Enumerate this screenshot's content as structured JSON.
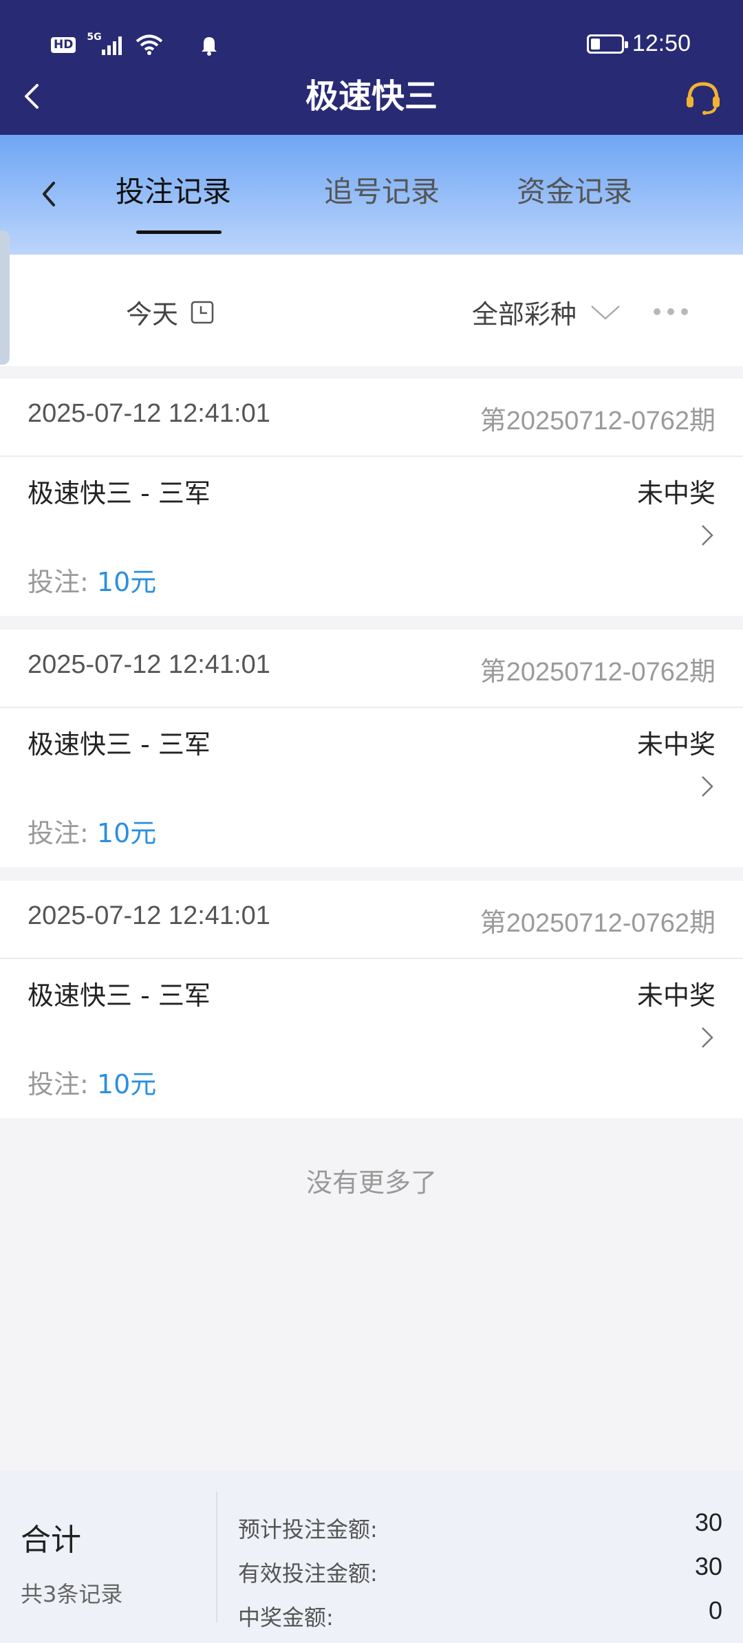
{
  "status_bar": {
    "hd": "HD",
    "network": "5G",
    "time": "12:50",
    "battery_level": 0.3
  },
  "header": {
    "title": "极速快三"
  },
  "tabs": [
    {
      "label": "投注记录",
      "active": true
    },
    {
      "label": "追号记录",
      "active": false
    },
    {
      "label": "资金记录",
      "active": false
    }
  ],
  "filter": {
    "date": "今天",
    "lottery_type": "全部彩种"
  },
  "records": [
    {
      "time": "2025-07-12 12:41:01",
      "period": "第20250712-0762期",
      "game": "极速快三 - 三军",
      "status": "未中奖",
      "bet_label": "投注:",
      "bet_amount": "10元"
    },
    {
      "time": "2025-07-12 12:41:01",
      "period": "第20250712-0762期",
      "game": "极速快三 - 三军",
      "status": "未中奖",
      "bet_label": "投注:",
      "bet_amount": "10元"
    },
    {
      "time": "2025-07-12 12:41:01",
      "period": "第20250712-0762期",
      "game": "极速快三 - 三军",
      "status": "未中奖",
      "bet_label": "投注:",
      "bet_amount": "10元"
    }
  ],
  "no_more_text": "没有更多了",
  "summary": {
    "label": "合计",
    "count_text": "共3条记录",
    "rows": [
      {
        "label": "预计投注金额:",
        "value": "30"
      },
      {
        "label": "有效投注金额:",
        "value": "30"
      },
      {
        "label": "中奖金额:",
        "value": "0"
      }
    ]
  },
  "colors": {
    "header_bg": "#282a74",
    "tab_gradient_top": "#6ea6f4",
    "tab_gradient_bottom": "#bcd5fb",
    "amount_blue": "#2a8fe0",
    "headset_orange": "#f2b233"
  }
}
